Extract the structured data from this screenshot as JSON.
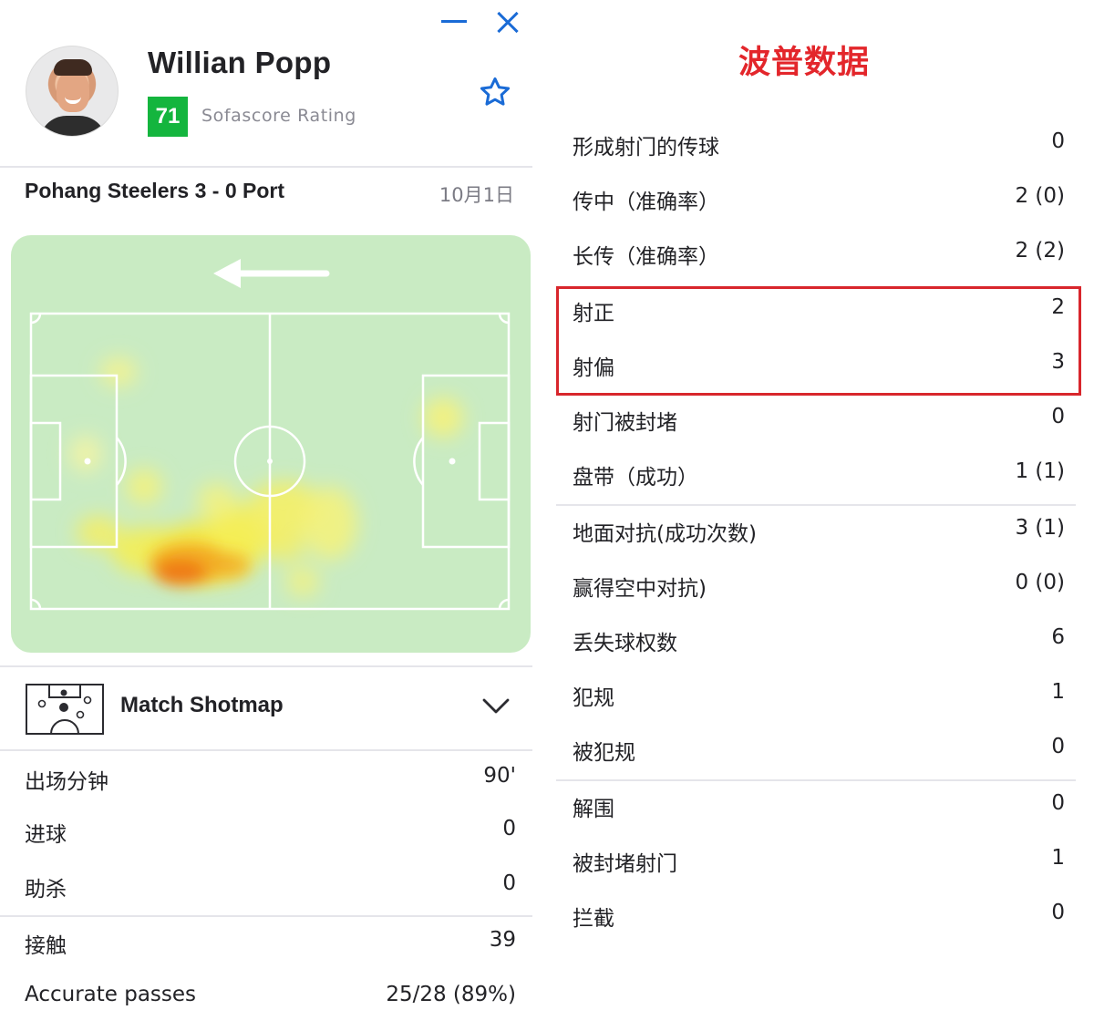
{
  "player": {
    "name": "Willian Popp",
    "rating": "71",
    "rating_label": "Sofascore Rating",
    "rating_color": "#14b53e"
  },
  "window_controls": {
    "minimize_icon": "minimize-icon",
    "close_icon": "close-icon",
    "favorite_icon": "star-icon",
    "accent_color": "#1a6bd6"
  },
  "match": {
    "title": "Pohang Steelers 3 - 0 Port",
    "date": "10月1日"
  },
  "heatmap": {
    "background_color": "#c9ebc3",
    "attack_direction": "left"
  },
  "shotmap": {
    "label": "Match Shotmap"
  },
  "left_stats": [
    {
      "label": "出场分钟",
      "value": "90'"
    },
    {
      "label": "进球",
      "value": "0"
    },
    {
      "label": "助杀",
      "value": "0"
    },
    {
      "label": "接触",
      "value": "39"
    },
    {
      "label": "Accurate passes",
      "value": "25/28 (89%)"
    }
  ],
  "right_panel": {
    "title": "波普数据",
    "title_color": "#e3262b",
    "highlight_color": "#d8262c",
    "stats": [
      {
        "label": "形成射门的传球",
        "value": "0"
      },
      {
        "label": "传中（准确率）",
        "value": "2 (0)"
      },
      {
        "label": "长传（准确率）",
        "value": "2 (2)"
      },
      {
        "label": "射正",
        "value": "2"
      },
      {
        "label": "射偏",
        "value": "3"
      },
      {
        "label": "射门被封堵",
        "value": "0"
      },
      {
        "label": "盘带（成功）",
        "value": "1 (1)"
      },
      {
        "label": "地面对抗(成功次数)",
        "value": "3 (1)"
      },
      {
        "label": "赢得空中对抗)",
        "value": "0 (0)"
      },
      {
        "label": "丢失球权数",
        "value": "6"
      },
      {
        "label": "犯规",
        "value": "1"
      },
      {
        "label": "被犯规",
        "value": "0"
      },
      {
        "label": "解围",
        "value": "0"
      },
      {
        "label": "被封堵射门",
        "value": "1"
      },
      {
        "label": "拦截",
        "value": "0"
      }
    ]
  }
}
